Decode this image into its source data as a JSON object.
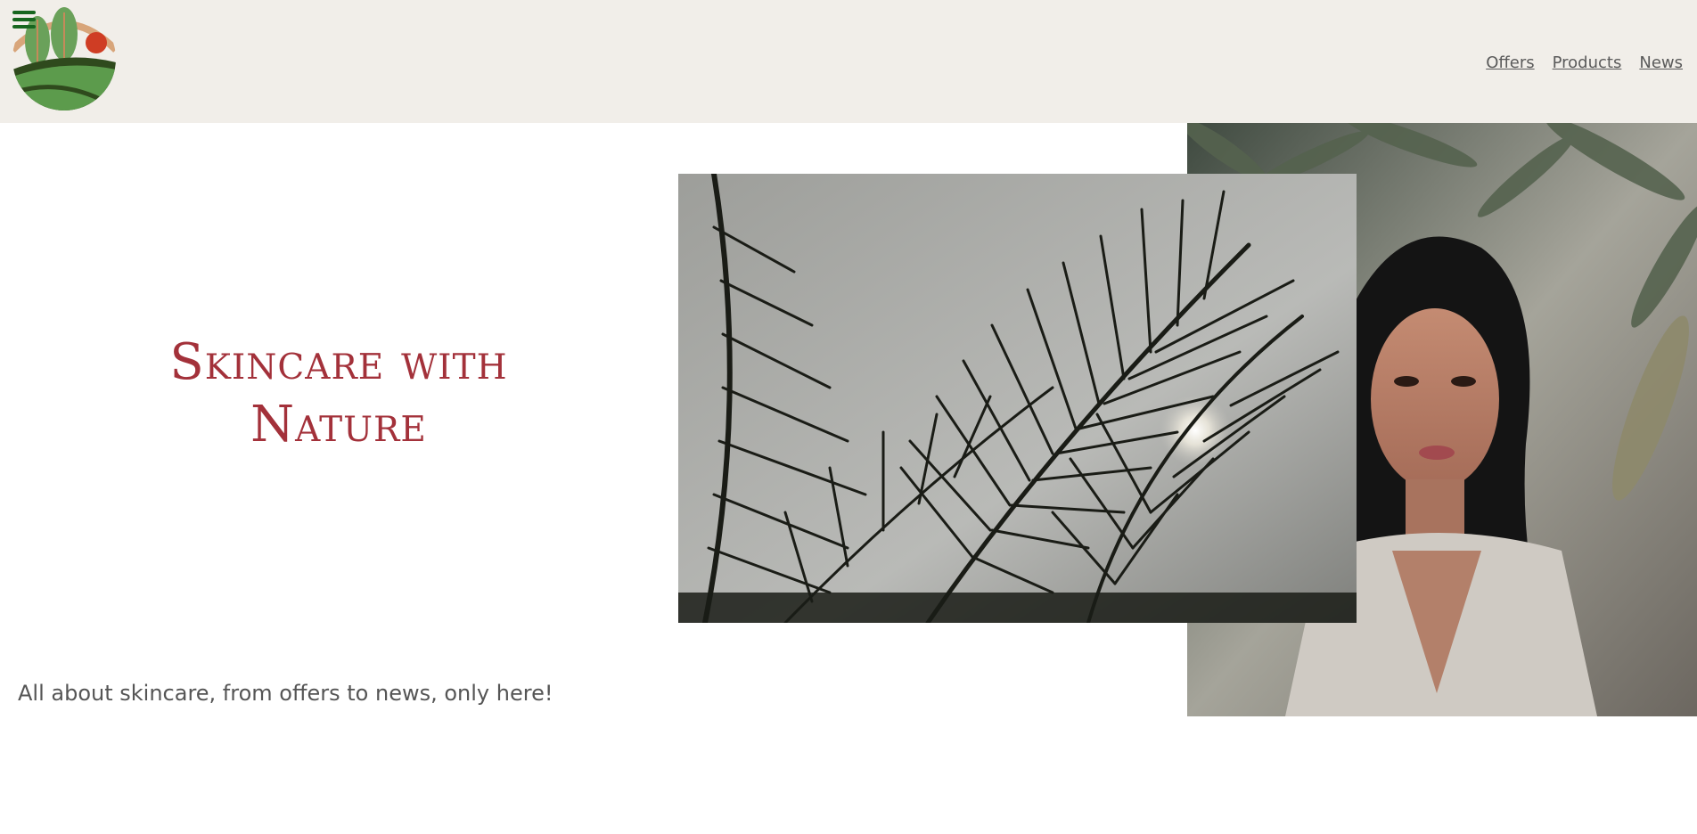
{
  "header": {
    "menu_icon": "hamburger-menu-icon",
    "logo_icon": "nature-landscape-logo-icon",
    "nav": [
      {
        "label": "Offers"
      },
      {
        "label": "Products"
      },
      {
        "label": "News"
      }
    ]
  },
  "hero": {
    "title_line1": "Skincare with",
    "title_line2": "Nature",
    "tagline": "All about skincare, from offers to news, only here!"
  },
  "colors": {
    "header_bg": "#f1eee9",
    "title": "#a3313a",
    "menu_icon": "#17661f",
    "text": "#555555"
  }
}
